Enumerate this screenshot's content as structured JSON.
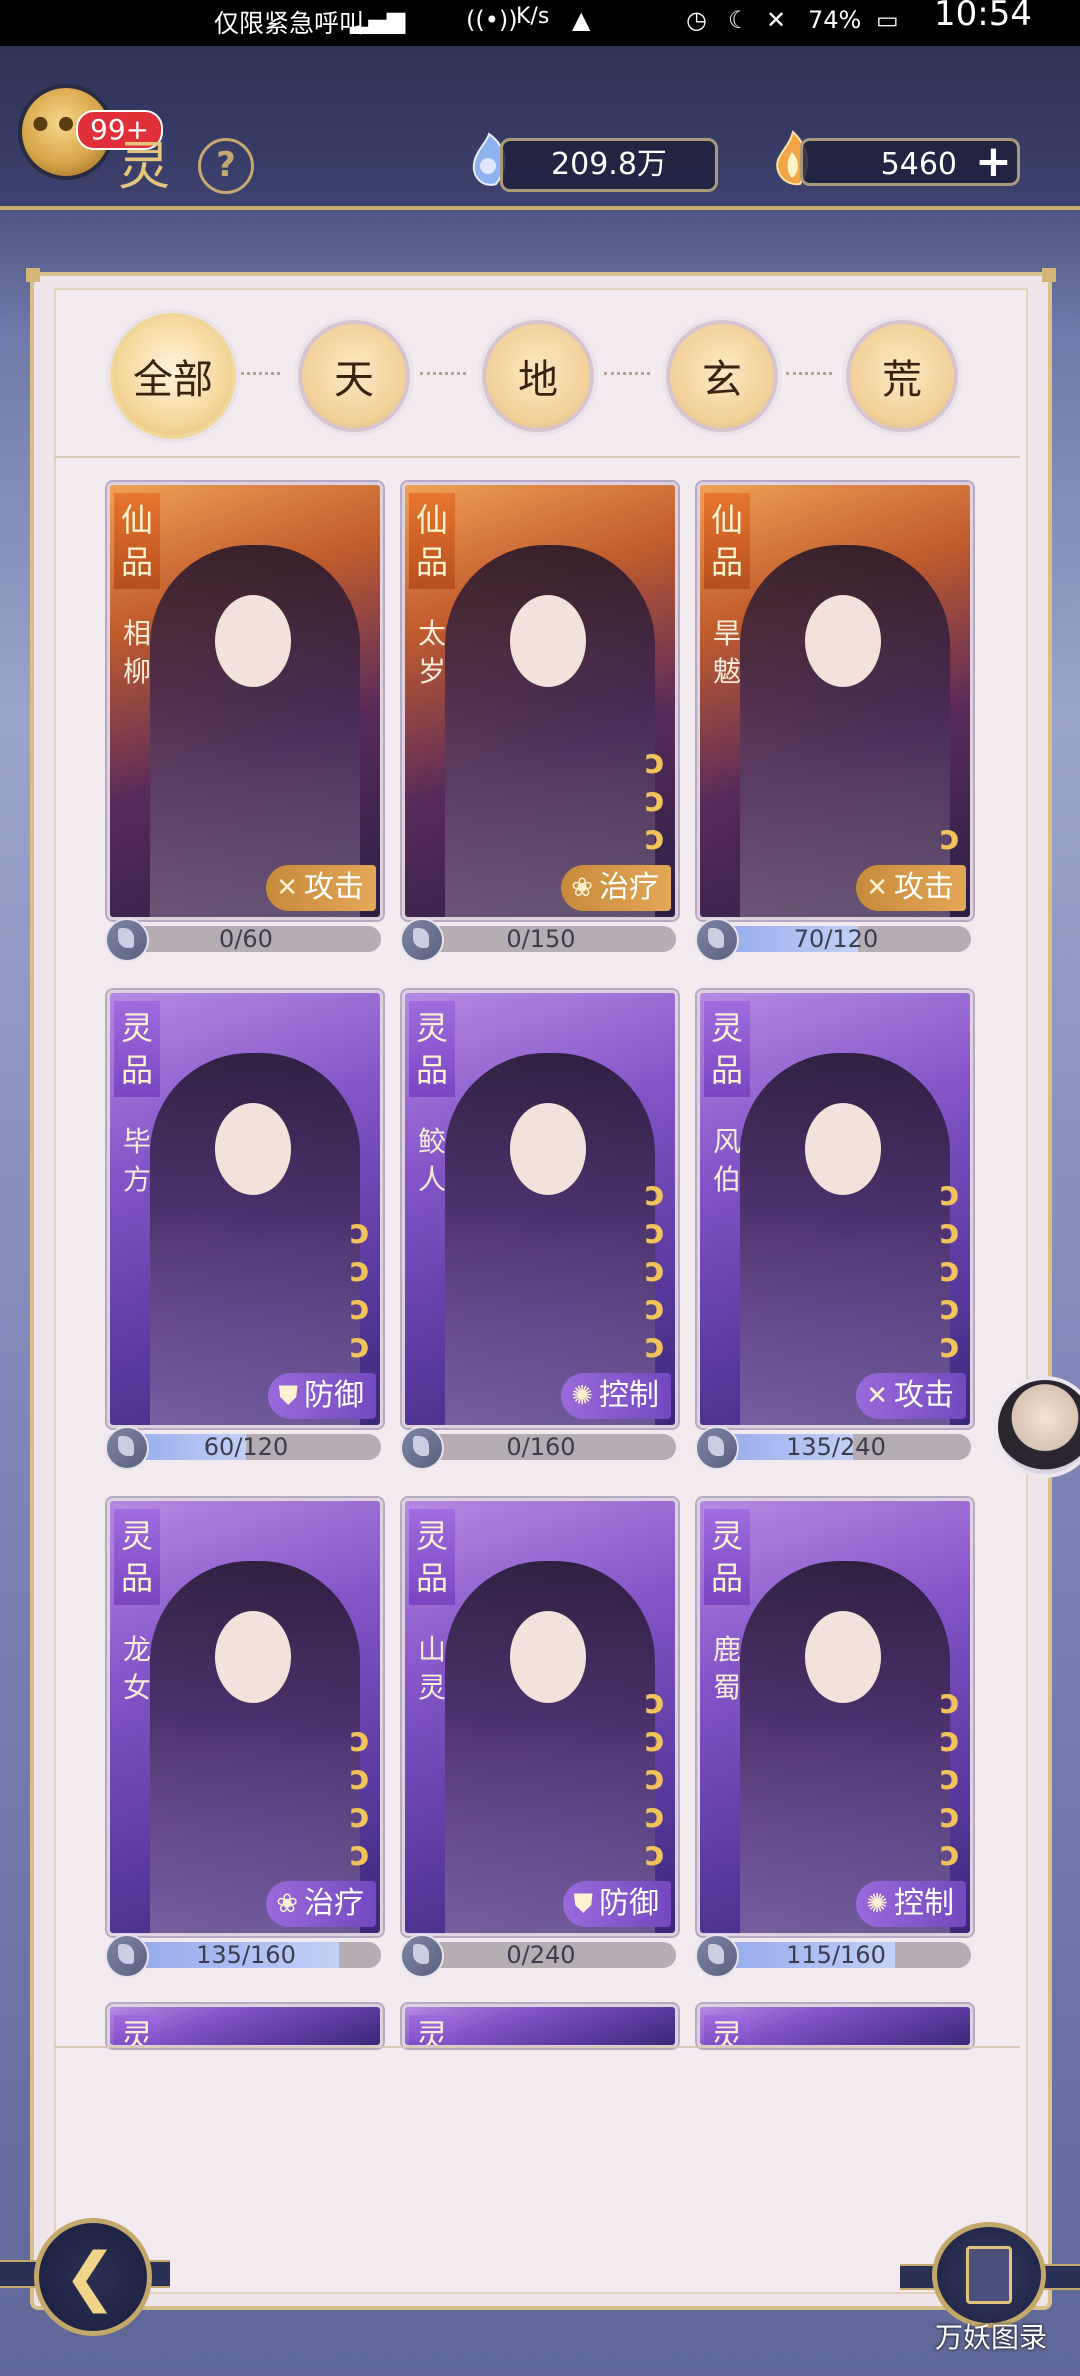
{
  "status_bar": {
    "carrier_text": "仅限紧急呼叫",
    "speed_unit": "K/s",
    "battery": "74%",
    "time": "10:54"
  },
  "header": {
    "chat_badge": "99+",
    "title_glyph": "灵",
    "help_symbol": "?",
    "currency_1": "209.8万",
    "currency_2": "5460",
    "add_symbol": "+"
  },
  "filters": {
    "tabs": [
      {
        "label": "全部",
        "active": true
      },
      {
        "label": "天",
        "active": false
      },
      {
        "label": "地",
        "active": false
      },
      {
        "label": "玄",
        "active": false
      },
      {
        "label": "荒",
        "active": false
      }
    ]
  },
  "cards": [
    {
      "grade": "仙品",
      "name": "相柳",
      "role": "攻击",
      "role_icon": "crossed-swords-icon",
      "marks": 0,
      "progress": "0/60",
      "fraction": 0.0,
      "style": "xian"
    },
    {
      "grade": "仙品",
      "name": "太岁",
      "role": "治疗",
      "role_icon": "lotus-icon",
      "marks": 3,
      "progress": "0/150",
      "fraction": 0.0,
      "style": "xian"
    },
    {
      "grade": "仙品",
      "name": "旱魃",
      "role": "攻击",
      "role_icon": "crossed-swords-icon",
      "marks": 1,
      "progress": "70/120",
      "fraction": 0.583,
      "style": "xian"
    },
    {
      "grade": "灵品",
      "name": "毕方",
      "role": "防御",
      "role_icon": "shield-icon",
      "marks": 4,
      "progress": "60/120",
      "fraction": 0.5,
      "style": "ling"
    },
    {
      "grade": "灵品",
      "name": "鲛人",
      "role": "控制",
      "role_icon": "swirl-icon",
      "marks": 5,
      "progress": "0/160",
      "fraction": 0.0,
      "style": "ling"
    },
    {
      "grade": "灵品",
      "name": "风伯",
      "role": "攻击",
      "role_icon": "crossed-swords-icon",
      "marks": 5,
      "progress": "135/240",
      "fraction": 0.5625,
      "style": "ling"
    },
    {
      "grade": "灵品",
      "name": "龙女",
      "role": "治疗",
      "role_icon": "lotus-icon",
      "marks": 4,
      "progress": "135/160",
      "fraction": 0.84375,
      "style": "ling"
    },
    {
      "grade": "灵品",
      "name": "山灵",
      "role": "防御",
      "role_icon": "shield-icon",
      "marks": 5,
      "progress": "0/240",
      "fraction": 0.0,
      "style": "ling"
    },
    {
      "grade": "灵品",
      "name": "鹿蜀",
      "role": "控制",
      "role_icon": "swirl-icon",
      "marks": 5,
      "progress": "115/160",
      "fraction": 0.71875,
      "style": "ling"
    }
  ],
  "partial_cards": [
    {
      "grade_hint": "灵"
    },
    {
      "grade_hint": "灵"
    },
    {
      "grade_hint": "灵"
    }
  ],
  "bottom": {
    "book_label": "万妖图录"
  },
  "colors": {
    "accent_gold": "#c9a968",
    "progress_fill": "#8fa6e8",
    "xian_orange": "#e7762f",
    "ling_purple": "#8454c8"
  }
}
